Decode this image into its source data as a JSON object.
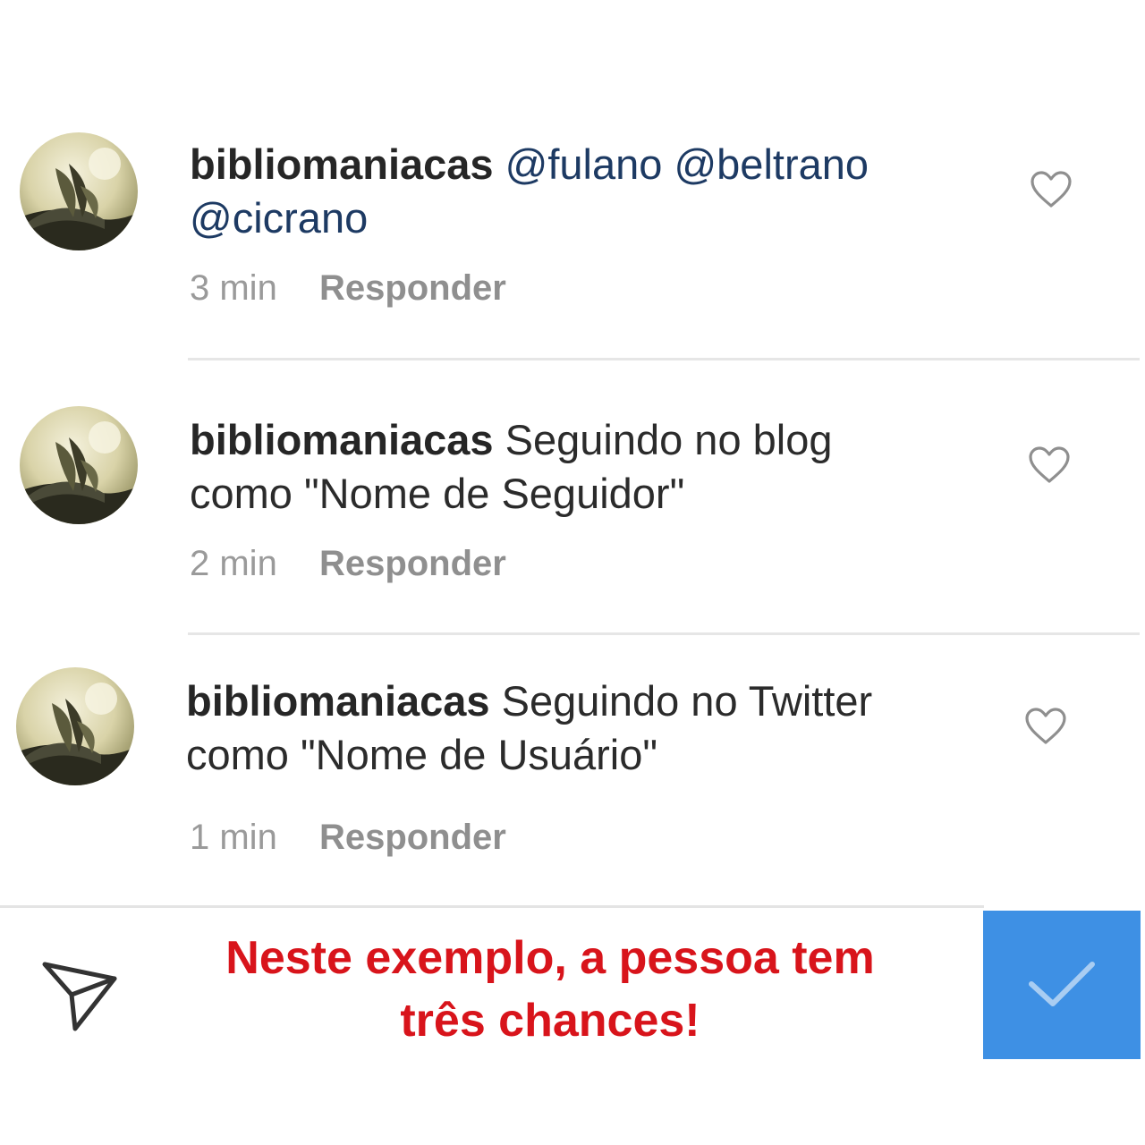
{
  "comments": [
    {
      "username": "bibliomaniacas",
      "mentions": "@fulano @beltrano",
      "mentions_line2": "@cicrano",
      "time": "3 min",
      "reply_label": "Responder",
      "like_icon": "heart-icon"
    },
    {
      "username": "bibliomaniacas",
      "text_line1": "Seguindo no blog",
      "text_line2": "como \"Nome de Seguidor\"",
      "time": "2 min",
      "reply_label": "Responder",
      "like_icon": "heart-icon"
    },
    {
      "username": "bibliomaniacas",
      "text_line1": "Seguindo no Twitter",
      "text_line2": "como \"Nome de Usuário\"",
      "time": "1 min",
      "reply_label": "Responder",
      "like_icon": "heart-icon"
    }
  ],
  "bottom_bar": {
    "send_icon": "paper-plane-icon",
    "caption_line1": "Neste exemplo, a pessoa tem",
    "caption_line2": "três chances!",
    "confirm_icon": "checkmark-icon"
  },
  "colors": {
    "mention": "#1d3a63",
    "caption": "#d8141b",
    "confirm_button": "#3e90e4",
    "meta_text": "#9a9a9a"
  }
}
